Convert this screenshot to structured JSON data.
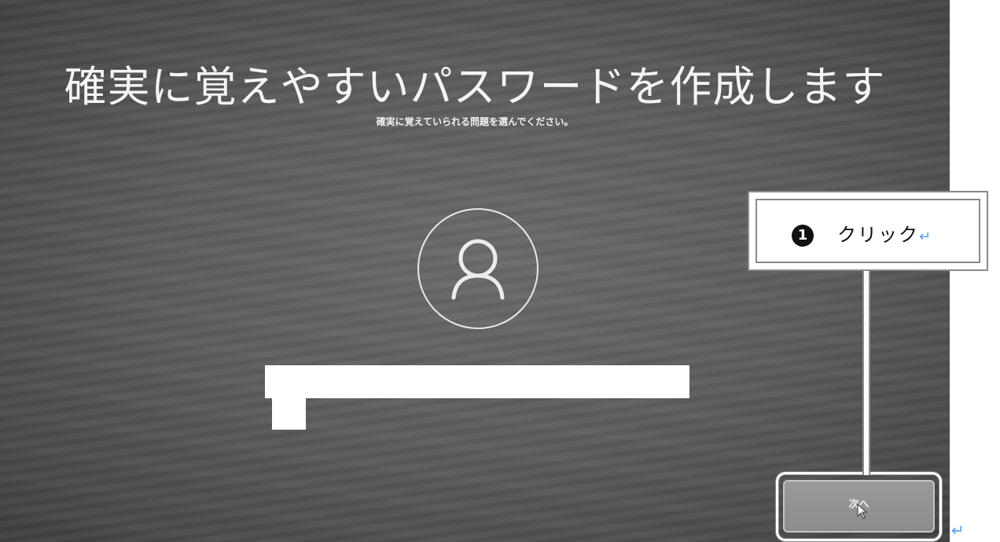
{
  "screen": {
    "title": "確実に覚えやすいパスワードを作成します",
    "subtitle": "確実に覚えていられる問題を選んでください。",
    "avatar_icon": "user-icon",
    "next_button_label": "次へ"
  },
  "callout": {
    "number": "1",
    "text": "クリック",
    "return_mark": "↵"
  },
  "document": {
    "return_mark": "↵"
  },
  "colors": {
    "screen_bg": "#5c5c5c",
    "callout_border": "#8a8a8a",
    "return_mark": "#5aa0e6"
  }
}
